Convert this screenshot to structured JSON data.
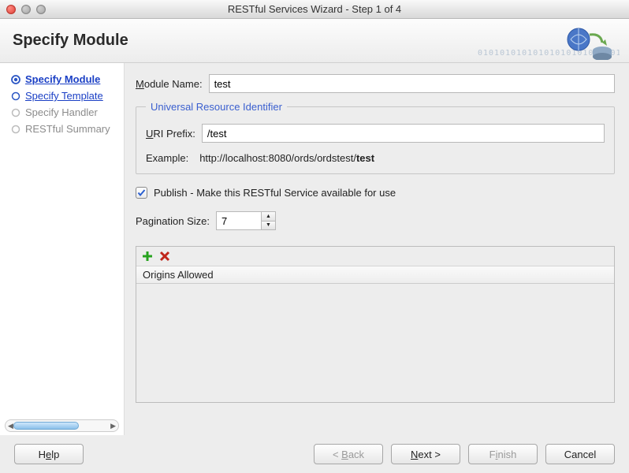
{
  "window": {
    "title": "RESTful Services Wizard - Step 1 of 4"
  },
  "banner": {
    "heading": "Specify Module"
  },
  "steps": [
    {
      "label": "Specify Module",
      "state": "active"
    },
    {
      "label": "Specify Template",
      "state": "link"
    },
    {
      "label": "Specify  Handler",
      "state": "disabled"
    },
    {
      "label": "RESTful Summary",
      "state": "disabled"
    }
  ],
  "form": {
    "module_name_label_pre": "M",
    "module_name_label_post": "odule Name:",
    "module_name_value": "test",
    "uri_legend": "Universal Resource Identifier",
    "uri_prefix_label_pre": "U",
    "uri_prefix_label_post": "RI Prefix:",
    "uri_prefix_value": "/test",
    "example_label": "Example:",
    "example_value_pre": "http://localhost:8080/ords/ordstest/",
    "example_value_bold": "test",
    "publish_checked": true,
    "publish_label_pre": "P",
    "publish_label_post": "ublish - Make this RESTful Service available for use",
    "pagination_label_pre": "Pagination ",
    "pagination_label_ul": "S",
    "pagination_label_post": "ize:",
    "pagination_value": "7",
    "origins_header": "Origins Allowed"
  },
  "footer": {
    "help_pre": "H",
    "help_ul": "e",
    "help_post": "lp",
    "back_pre": "< ",
    "back_ul": "B",
    "back_post": "ack",
    "next_pre": "N",
    "next_ul": "e",
    "next_post": "xt >",
    "finish_pre": "F",
    "finish_ul": "i",
    "finish_post": "nish",
    "cancel": "Cancel"
  }
}
